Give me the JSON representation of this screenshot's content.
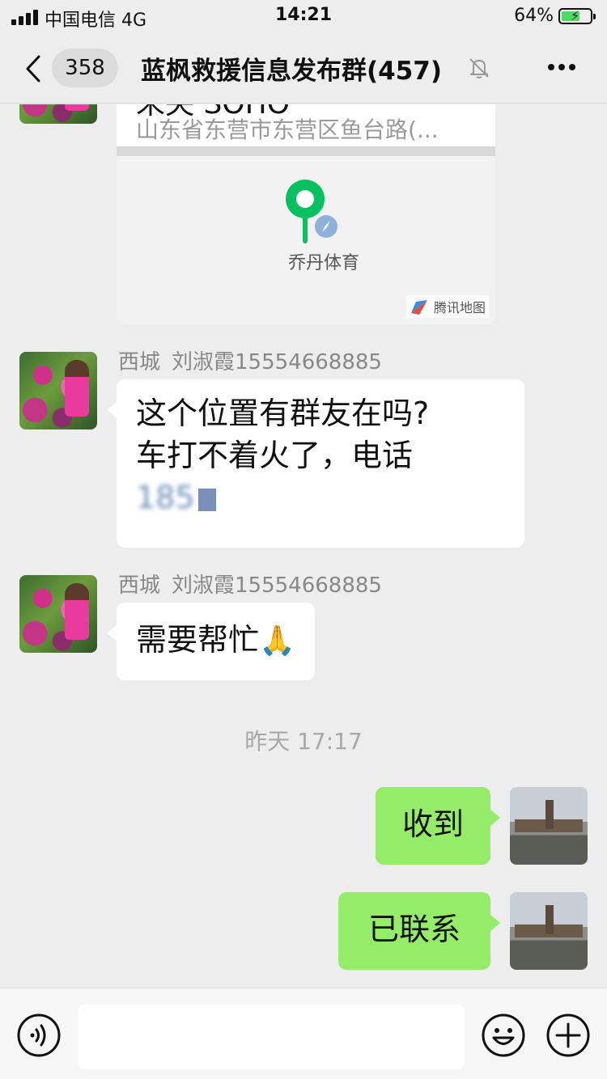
{
  "status_bar": {
    "carrier": "中国电信  4G",
    "time": "14:21",
    "battery": "64%"
  },
  "nav": {
    "badge": "358",
    "title": "蓝枫救援信息发布群(457)",
    "icons": [
      "back-icon",
      "mute-icon",
      "more-icon"
    ]
  },
  "location_card": {
    "name": "未央 SOHO",
    "address": "山东省东营市东营区鱼台路(...",
    "poi": "乔丹体育",
    "map_brand": "腾讯地图"
  },
  "messages": [
    {
      "sender_group": "西城",
      "sender_name": "刘淑霞15554668885",
      "text_line1": "这个位置有群友在吗?",
      "text_line2": "车打不着火了，电话",
      "text_line3": "185"
    },
    {
      "sender_group": "西城",
      "sender_name": "刘淑霞15554668885",
      "text": "需要帮忙",
      "emoji": "🙏"
    }
  ],
  "timestamp": "昨天 17:17",
  "my_messages": [
    {
      "text": "收到"
    },
    {
      "text": "已联系"
    }
  ],
  "input_bar": {
    "icons": [
      "voice-icon",
      "emoji-icon",
      "plus-icon"
    ]
  },
  "colors": {
    "background": "#ededed",
    "my_bubble": "#95ec69",
    "other_bubble": "#ffffff",
    "map_pin": "#07c160"
  }
}
